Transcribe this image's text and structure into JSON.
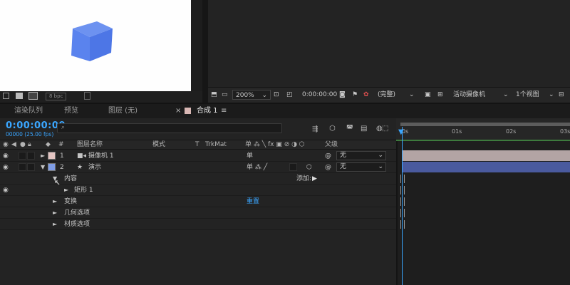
{
  "project": {
    "bpc_label": "8 bpc"
  },
  "viewer": {
    "zoom": "200%",
    "timecode": "0:00:00:00",
    "resolution": "(完整)",
    "camera": "活动摄像机",
    "views": "1个视图"
  },
  "tabs": {
    "render_queue": "渲染队列",
    "preview": "预览",
    "layer": "图层 (无)",
    "comp": "合成 1",
    "comp_menu": "≡",
    "close": "×"
  },
  "timeline": {
    "timecode": "0:00:00:00",
    "fps": "00000 (25.00 fps)",
    "search_icon": "⌕",
    "columns": {
      "number": "#",
      "layer_name": "图层名称",
      "mode": "模式",
      "t": "T",
      "trkmat": "TrkMat",
      "switches": "单 ⁂ ╲ fx ▣ ⊘ ◑ ⬡",
      "parent": "父级"
    },
    "layers": [
      {
        "index": "1",
        "name": "摄像机 1",
        "icon": "camera-icon",
        "parent": "无",
        "swatch": "#e3c4c1"
      },
      {
        "index": "2",
        "name": "演示",
        "icon": "star-icon",
        "parent": "无",
        "swatch": "#7f9de6"
      }
    ],
    "props": {
      "contents": "内容",
      "add": "添加:",
      "rectangle": "矩形 1",
      "transform": "变换",
      "reset": "重置",
      "geometry": "几何选项",
      "material": "材质选项"
    },
    "ruler": [
      "0s",
      "01s",
      "02s",
      "03s"
    ],
    "colors": {
      "accent": "#3aa6ff",
      "camera_bar": "#b3a4a4",
      "shape_bar": "#4a5a9e",
      "cube": "#5a83ee"
    }
  }
}
